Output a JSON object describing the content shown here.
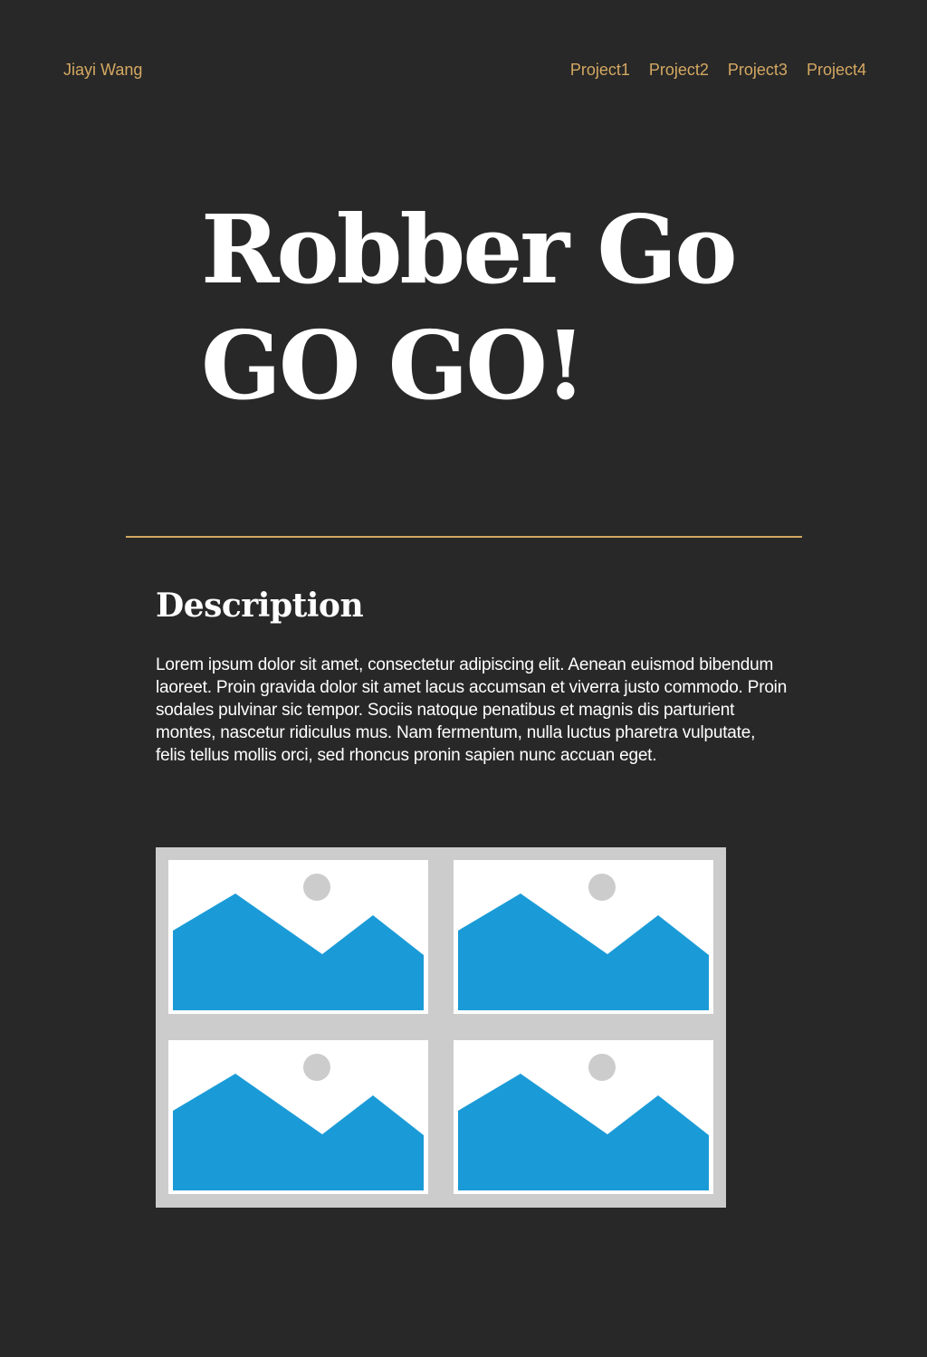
{
  "header": {
    "brand": "Jiayi Wang",
    "nav": [
      {
        "label": "Project1"
      },
      {
        "label": "Project2"
      },
      {
        "label": "Project3"
      },
      {
        "label": "Project4"
      }
    ]
  },
  "hero": {
    "title": "Robber Go GO GO!"
  },
  "colors": {
    "background": "#282828",
    "accent": "#d4a862",
    "text": "#ffffff",
    "gallery_frame": "#cccccc",
    "placeholder_mountain": "#1a9bd7",
    "placeholder_sun": "#cccccc"
  },
  "description": {
    "heading": "Description",
    "body": "Lorem ipsum dolor sit amet, consectetur adipiscing elit. Aenean euismod bibendum laoreet. Proin gravida dolor sit amet lacus accumsan et viverra justo commodo. Proin sodales pulvinar sic tempor. Sociis natoque penatibus et magnis dis parturient montes, nascetur ridiculus mus. Nam fermentum, nulla luctus pharetra vulputate, felis tellus mollis orci, sed rhoncus pronin sapien nunc accuan eget."
  },
  "gallery": {
    "icon": "image-placeholder-icon",
    "items": [
      {},
      {},
      {},
      {}
    ]
  }
}
